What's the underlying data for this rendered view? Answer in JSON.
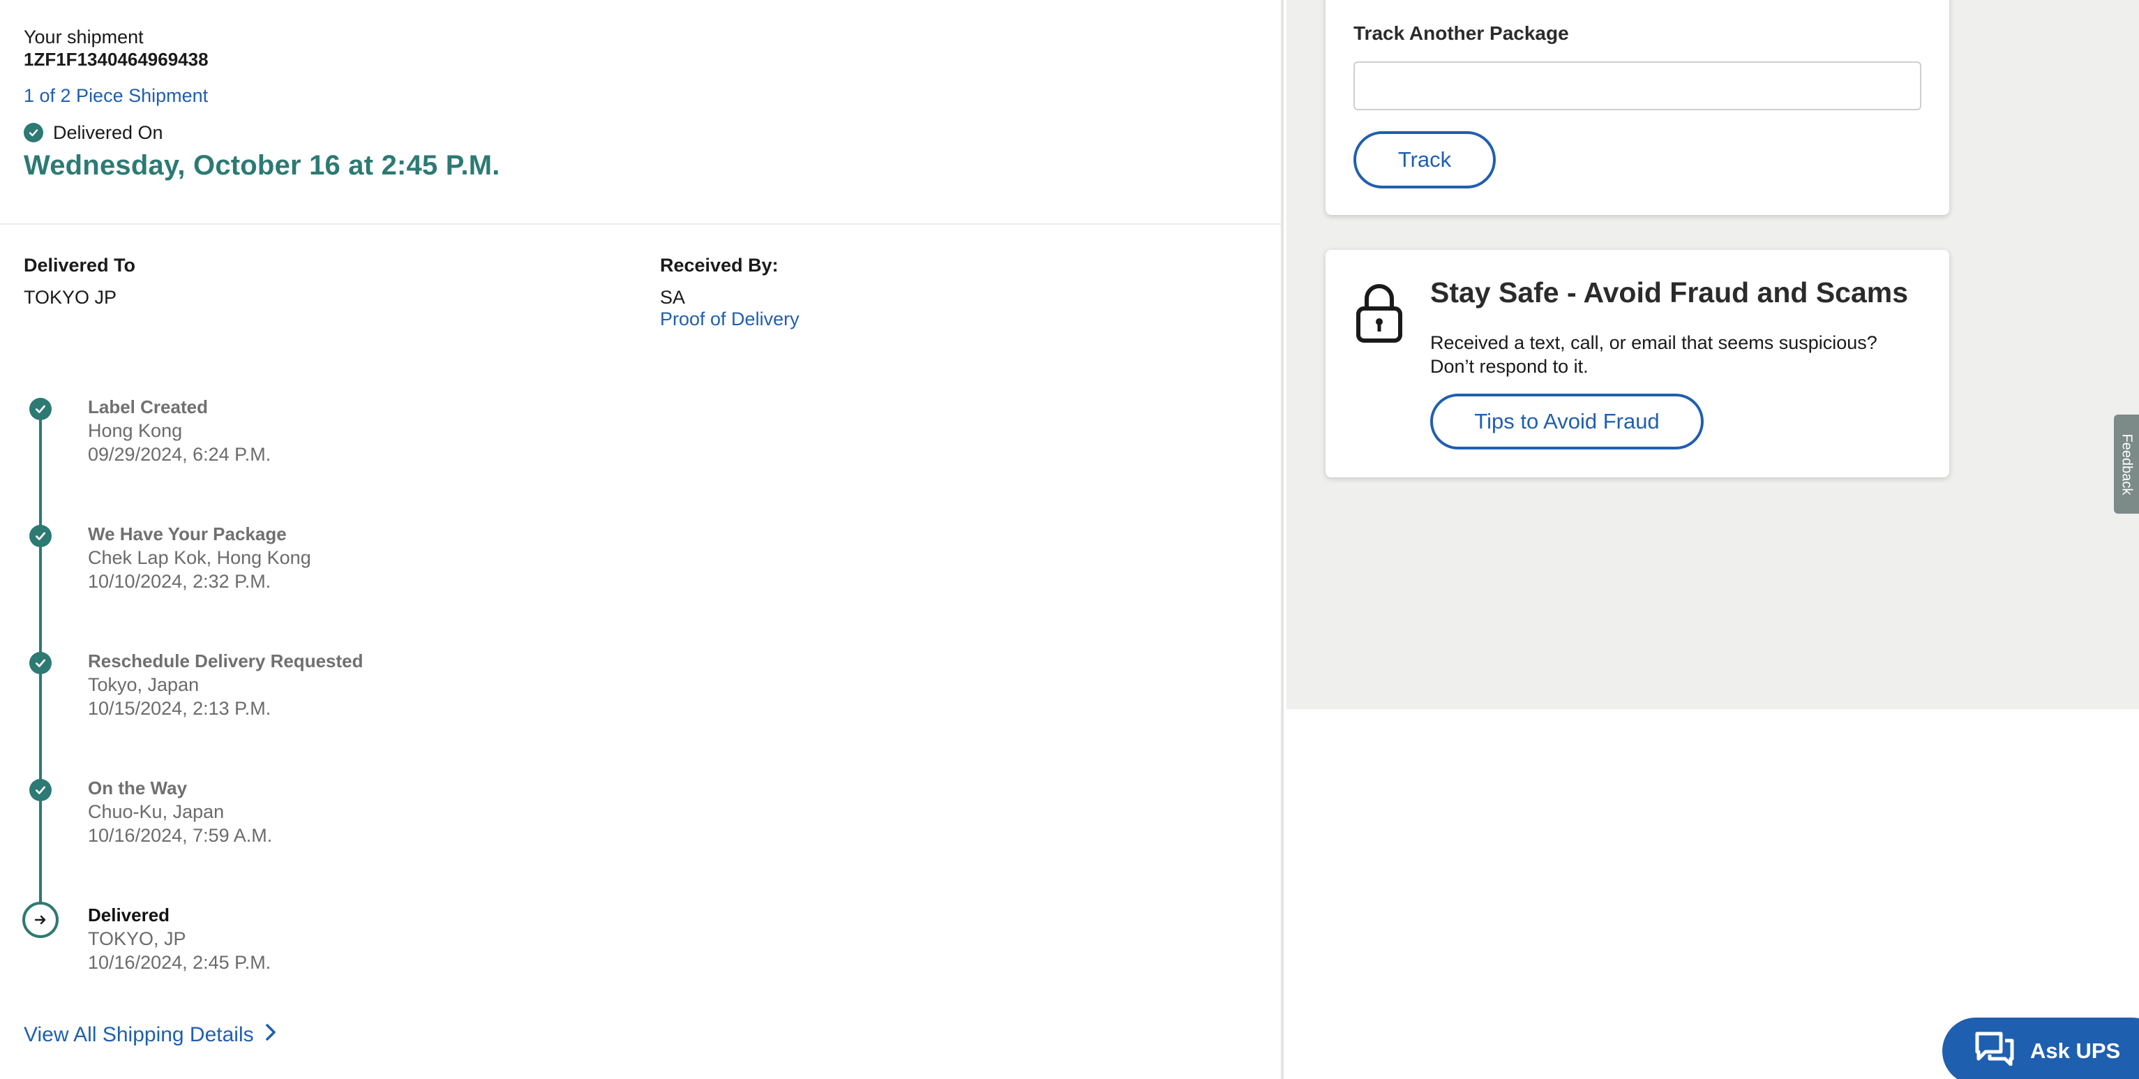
{
  "shipment": {
    "label": "Your shipment",
    "tracking_number": "1ZF1F1340464969438",
    "piece_link": "1 of 2 Piece Shipment",
    "status_label": "Delivered On",
    "delivered_date": "Wednesday, October 16 at 2:45 P.M."
  },
  "delivery_details": {
    "delivered_to_label": "Delivered To",
    "delivered_to_value": "TOKYO JP",
    "received_by_label": "Received By:",
    "received_by_value": "SA",
    "proof_link": "Proof of Delivery"
  },
  "timeline": [
    {
      "title": "Label Created",
      "location": "Hong Kong",
      "datetime": "09/29/2024, 6:24 P.M."
    },
    {
      "title": "We Have Your Package",
      "location": "Chek Lap Kok, Hong Kong",
      "datetime": "10/10/2024, 2:32 P.M."
    },
    {
      "title": "Reschedule Delivery Requested",
      "location": "Tokyo, Japan",
      "datetime": "10/15/2024, 2:13 P.M."
    },
    {
      "title": "On the Way",
      "location": "Chuo-Ku, Japan",
      "datetime": "10/16/2024, 7:59 A.M."
    },
    {
      "title": "Delivered",
      "location": "TOKYO, JP",
      "datetime": "10/16/2024, 2:45 P.M."
    }
  ],
  "view_all_link": "View All Shipping Details",
  "track_card": {
    "label": "Track Another Package",
    "input_value": "",
    "input_placeholder": "",
    "button_label": "Track"
  },
  "fraud_card": {
    "title": "Stay Safe - Avoid Fraud and Scams",
    "body": "Received a text, call, or email that seems suspicious? Don’t respond to it.",
    "button_label": "Tips to Avoid Fraud"
  },
  "feedback_tab": "Feedback",
  "ask_ups": "Ask UPS",
  "colors": {
    "accent_teal": "#2c7a73",
    "link_blue": "#1f5fb0",
    "panel_gray": "#efefee"
  }
}
